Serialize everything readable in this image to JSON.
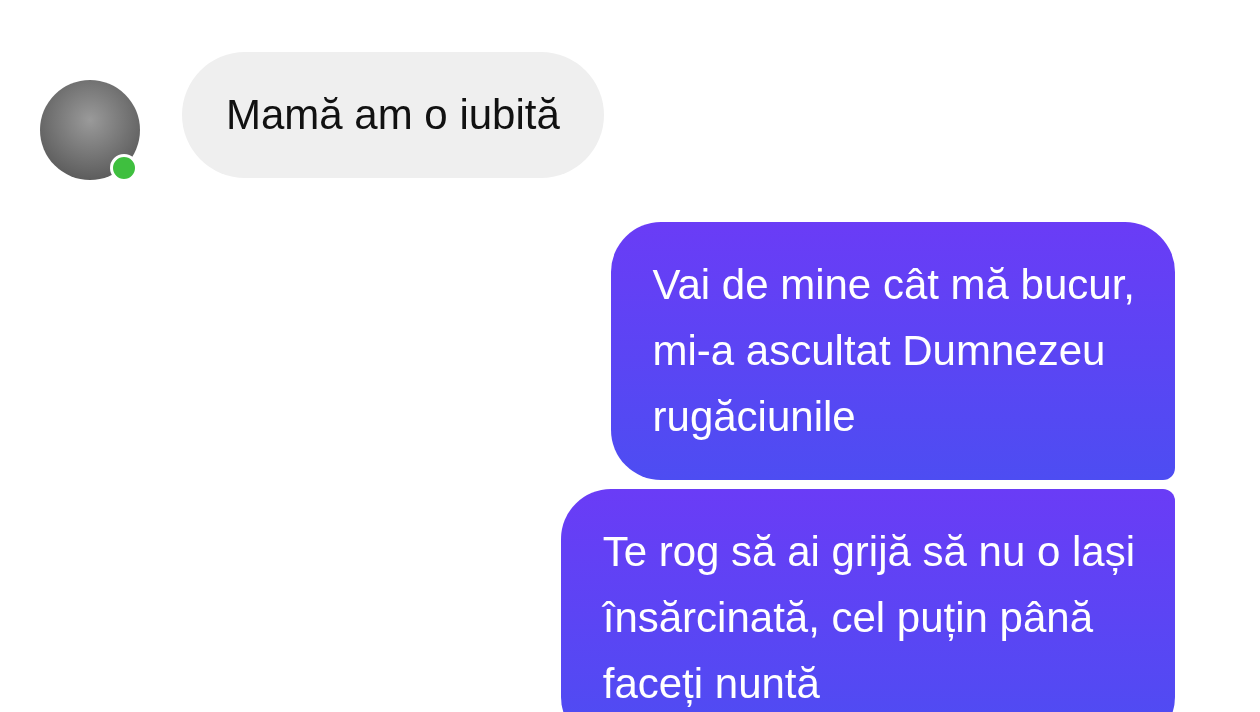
{
  "contact": {
    "online": true
  },
  "messages": [
    {
      "kind": "received",
      "lines": [
        "Mamă am o iubită"
      ]
    },
    {
      "kind": "sent",
      "lines": [
        "Vai de mine cât mă bucur,",
        "mi-a ascultat Dumnezeu",
        "rugăciunile"
      ]
    },
    {
      "kind": "sent",
      "lines": [
        "Te rog să ai grijă să nu o lași",
        "însărcinată, cel puțin până",
        "faceți nuntă"
      ]
    }
  ]
}
